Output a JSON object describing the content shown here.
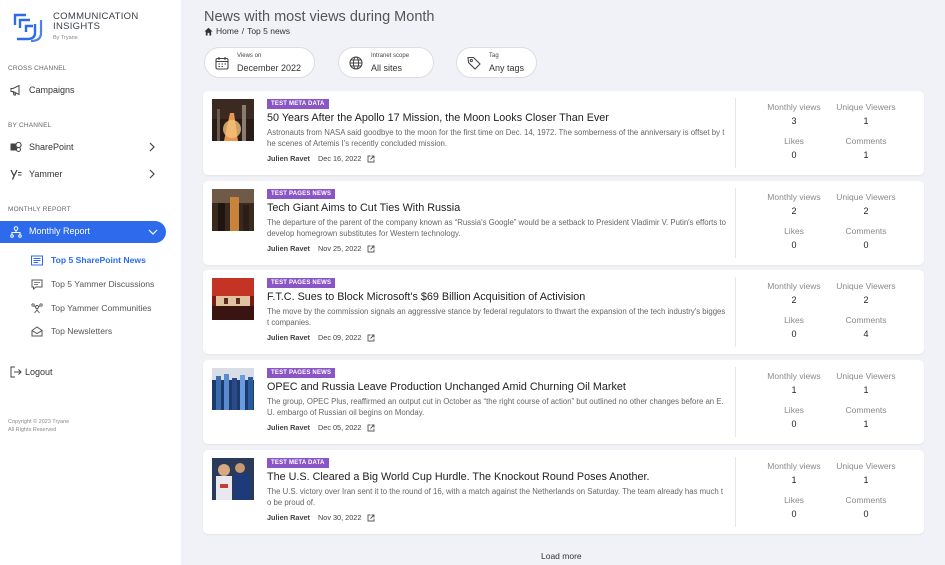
{
  "brand": {
    "title_line1": "COMMUNICATION",
    "title_line2": "INSIGHTS",
    "subtitle": "By Tryane",
    "accent": "#2d6bec"
  },
  "sidebar": {
    "cross_channel_label": "CROSS CHANNEL",
    "campaigns": "Campaigns",
    "by_channel_label": "BY CHANNEL",
    "sharepoint": "SharePoint",
    "yammer": "Yammer",
    "monthly_report_label": "MONTHLY REPORT",
    "monthly_report": "Monthly Report",
    "sub_items": [
      "Top 5 SharePoint News",
      "Top 5 Yammer Discussions",
      "Top Yammer Communities",
      "Top Newsletters"
    ],
    "logout": "Logout",
    "copyright_line1": "Copyright © 2023 Tryane",
    "copyright_line2": "All Rights Reserved"
  },
  "header": {
    "title": "News with most views during Month",
    "breadcrumb_home": "Home",
    "breadcrumb_sep": "/",
    "breadcrumb_current": "Top 5 news"
  },
  "filters": [
    {
      "label": "Views on",
      "value": "December 2022",
      "icon": "calendar-icon"
    },
    {
      "label": "Intranet scope",
      "value": "All sites",
      "icon": "globe-icon"
    },
    {
      "label": "Tag",
      "value": "Any tags",
      "icon": "tag-icon"
    }
  ],
  "stat_labels": {
    "monthly_views": "Monthly views",
    "unique_viewers": "Unique Viewers",
    "likes": "Likes",
    "comments": "Comments"
  },
  "news": [
    {
      "tag": "TEST META DATA",
      "title": "50 Years After the Apollo 17 Mission, the Moon Looks Closer Than Ever",
      "description": "Astronauts from NASA said goodbye to the moon for the first time on Dec. 14, 1972. The somberness of the anniversary is offset by the scenes of Artemis I's recently concluded mission.",
      "author": "Julien Ravet",
      "date": "Dec 16, 2022",
      "monthly_views": "3",
      "unique_viewers": "1",
      "likes": "0",
      "comments": "1"
    },
    {
      "tag": "TEST PAGES NEWS",
      "title": "Tech Giant Aims to Cut Ties With Russia",
      "description": "The departure of the parent of the company known as “Russia's Google” would be a setback to President Vladimir V. Putin's efforts to develop homegrown substitutes for Western technology.",
      "author": "Julien Ravet",
      "date": "Nov 25, 2022",
      "monthly_views": "2",
      "unique_viewers": "2",
      "likes": "0",
      "comments": "0"
    },
    {
      "tag": "TEST PAGES NEWS",
      "title": "F.T.C. Sues to Block Microsoft's $69 Billion Acquisition of Activision",
      "description": "The move by the commission signals an aggressive stance by federal regulators to thwart the expansion of the tech industry's biggest companies.",
      "author": "Julien Ravet",
      "date": "Dec 09, 2022",
      "monthly_views": "2",
      "unique_viewers": "2",
      "likes": "0",
      "comments": "4"
    },
    {
      "tag": "TEST PAGES NEWS",
      "title": "OPEC and Russia Leave Production Unchanged Amid Churning Oil Market",
      "description": "The group, OPEC Plus, reaffirmed an output cut in October as “the right course of action” but outlined no other changes before an E.U. embargo of Russian oil begins on Monday.",
      "author": "Julien Ravet",
      "date": "Dec 05, 2022",
      "monthly_views": "1",
      "unique_viewers": "1",
      "likes": "0",
      "comments": "1"
    },
    {
      "tag": "TEST META DATA",
      "title": "The U.S. Cleared a Big World Cup Hurdle. The Knockout Round Poses Another.",
      "description": "The U.S. victory over Iran sent it to the round of 16, with a match against the Netherlands on Saturday. The team already has much to be proud of.",
      "author": "Julien Ravet",
      "date": "Nov 30, 2022",
      "monthly_views": "1",
      "unique_viewers": "1",
      "likes": "0",
      "comments": "0"
    }
  ],
  "load_more": "Load more"
}
